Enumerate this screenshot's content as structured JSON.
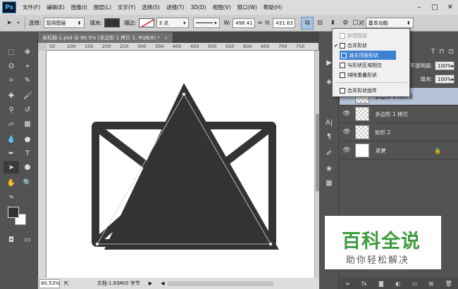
{
  "app": {
    "logo": "Ps"
  },
  "menu": [
    "文件(F)",
    "编辑(E)",
    "图像(I)",
    "图层(L)",
    "文字(Y)",
    "选择(S)",
    "滤镜(T)",
    "3D(D)",
    "视图(V)",
    "窗口(W)",
    "帮助(H)"
  ],
  "options": {
    "select_label": "选择:",
    "select_value": "现用图层",
    "fill_label": "填充:",
    "stroke_label": "描边:",
    "stroke_width": "3 点",
    "w_label": "W:",
    "w_value": "498.41",
    "h_label": "H:",
    "h_value": "431.63",
    "workspace": "基本功能",
    "fill_color": "#333333",
    "stroke_color": "#cc2222"
  },
  "document": {
    "tab_title": "未标题-1.psd @ 80.5% (多边形 1 拷贝 2, RGB/8) *",
    "tab_close": "×",
    "ruler_ticks": [
      "50",
      "100",
      "150",
      "200",
      "250",
      "300",
      "350",
      "400",
      "450",
      "500",
      "550",
      "600",
      "650",
      "700",
      "750"
    ],
    "zoom": "80.53%",
    "doc_info": "文档:1.83M/0 字节"
  },
  "shape_menu": {
    "items": [
      {
        "label": "新建图层",
        "checked": false,
        "disabled": true
      },
      {
        "label": "合并形状",
        "checked": true,
        "disabled": false
      },
      {
        "label": "减去顶层形状",
        "checked": false,
        "disabled": false,
        "highlight": true
      },
      {
        "label": "与形状区域相交",
        "checked": false,
        "disabled": false
      },
      {
        "label": "排除重叠形状",
        "checked": false,
        "disabled": false
      },
      {
        "label": "合并形状组件",
        "checked": false,
        "disabled": false
      }
    ]
  },
  "layers": {
    "opacity_label": "不透明度:",
    "opacity_value": "100%",
    "fill_label": "填充:",
    "fill_value": "100%",
    "items": [
      {
        "name": "多边形 1 拷贝 2",
        "selected": true
      },
      {
        "name": "多边形 1 拷贝",
        "selected": false
      },
      {
        "name": "矩形 2",
        "selected": false
      },
      {
        "name": "背景",
        "selected": false,
        "locked": true
      }
    ]
  },
  "watermark": {
    "title": "百科全说",
    "subtitle": "助你轻松解决"
  },
  "colors": {
    "accent": "#3d7fd0",
    "shape": "#333333",
    "panel": "#535353"
  }
}
